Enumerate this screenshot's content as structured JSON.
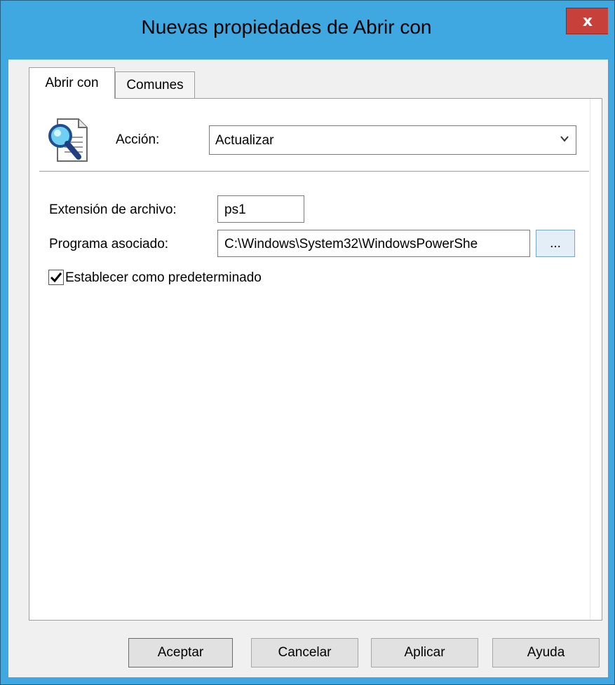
{
  "window": {
    "title": "Nuevas propiedades de Abrir con",
    "close_label": "x"
  },
  "tabs": [
    {
      "label": "Abrir con",
      "selected": true
    },
    {
      "label": "Comunes",
      "selected": false
    }
  ],
  "form": {
    "action_label": "Acción:",
    "action_value": "Actualizar",
    "extension_label": "Extensión de archivo:",
    "extension_value": "ps1",
    "program_label": "Programa asociado:",
    "program_value": "C:\\Windows\\System32\\WindowsPowerShe",
    "browse_label": "...",
    "default_checkbox_label": "Establecer como predeterminado",
    "default_checked": true
  },
  "buttons": {
    "ok": "Aceptar",
    "cancel": "Cancelar",
    "apply": "Aplicar",
    "help": "Ayuda"
  },
  "colors": {
    "titlebar": "#3fa8e0",
    "close_button": "#c7403a"
  },
  "icons": {
    "document": "document-magnifier-icon",
    "dropdown": "chevron-down-icon",
    "check": "checkmark-icon",
    "close": "close-icon"
  }
}
